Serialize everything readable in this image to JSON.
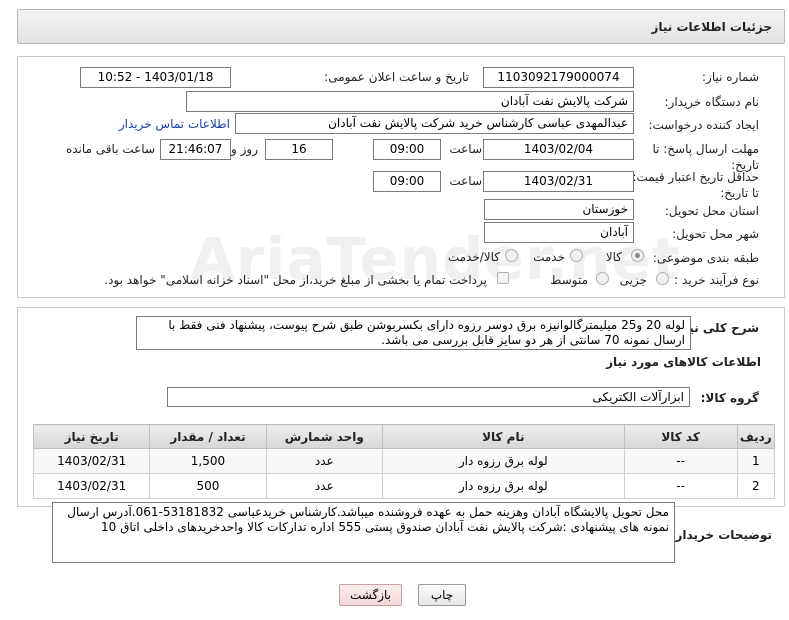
{
  "header": {
    "title": "جزئیات اطلاعات نیاز"
  },
  "form": {
    "need_number_label": "شماره نیاز:",
    "need_number": "1103092179000074",
    "announce_label": "تاریخ و ساعت اعلان عمومی:",
    "announce_value": "1403/01/18 - 10:52",
    "buyer_org_label": "نام دستگاه خریدار:",
    "buyer_org": "شرکت پالایش نفت آبادان",
    "requester_label": "ایجاد کننده درخواست:",
    "requester": "عبدالمهدی  عباسی کارشناس خرید شرکت پالایش نفت آبادان",
    "contact_link": "اطلاعات تماس خریدار",
    "deadline_label": "مهلت ارسال پاسخ: تا تاریخ:",
    "deadline_date": "1403/02/04",
    "time_label": "ساعت",
    "deadline_time": "09:00",
    "days_value": "16",
    "days_label": "روز و",
    "remaining_time": "21:46:07",
    "remaining_label": "ساعت باقی مانده",
    "price_validity_label": "حداقل تاریخ اعتبار قیمت: تا تاریخ:",
    "price_validity_date": "1403/02/31",
    "price_validity_time": "09:00",
    "province_label": "استان محل تحویل:",
    "province": "خوزستان",
    "city_label": "شهر محل تحویل:",
    "city": "آبادان",
    "category_label": "طبقه بندی موضوعی:",
    "category_options": [
      "کالا",
      "خدمت",
      "کالا/خدمت"
    ],
    "process_label": "نوع فرآیند خرید :",
    "process_options": [
      "جزیی",
      "متوسط"
    ],
    "payment_note": "پرداخت تمام یا بخشی از مبلغ خرید،از محل \"اسناد خزانه اسلامی\" خواهد بود."
  },
  "description": {
    "label": "شرح کلی نیاز:",
    "text": "لوله 20 و25 میلیمترگالوانیزه برق دوسر رزوه دارای بکسربوشن طبق شرح پیوست، پیشنهاد فنی فقط با ارسال نمونه 70 سانتی از هر دو سایز قابل بررسی می باشد."
  },
  "goods": {
    "section_title": "اطلاعات کالاهای مورد نیاز",
    "group_label": "گروه کالا:",
    "group_value": "ابزارآلات الکتریکی",
    "columns": [
      "ردیف",
      "کد کالا",
      "نام کالا",
      "واحد شمارش",
      "تعداد / مقدار",
      "تاریخ نیاز"
    ],
    "rows": [
      [
        "1",
        "--",
        "لوله برق رزوه دار",
        "عدد",
        "1,500",
        "1403/02/31"
      ],
      [
        "2",
        "--",
        "لوله برق رزوه دار",
        "عدد",
        "500",
        "1403/02/31"
      ]
    ]
  },
  "buyer_notes": {
    "label": "توضیحات خریدار:",
    "text": "محل تحویل پالایشگاه آبادان وهزینه حمل به عهده فروشنده میباشد.کارشناس خریدعباسی 53181832-061.آدرس ارسال نمونه های پیشنهادی :شرکت پالایش نفت آبادان صندوق پستی 555 اداره تدارکات کالا واحدخریدهای داخلی اتاق 10"
  },
  "buttons": {
    "print": "چاپ",
    "back": "بازگشت"
  }
}
